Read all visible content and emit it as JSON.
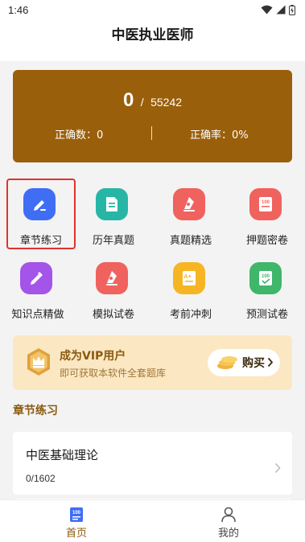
{
  "status_bar": {
    "time": "1:46"
  },
  "header": {
    "title": "中医执业医师"
  },
  "stats": {
    "done": "0",
    "separator": "/",
    "total": "55242",
    "correct_count_label": "正确数：0",
    "correct_rate_label": "正确率：0%"
  },
  "menu": [
    {
      "label": "章节练习",
      "icon": "pencil-icon",
      "color": "#3f6ef5"
    },
    {
      "label": "历年真题",
      "icon": "document-icon",
      "color": "#27b6a6"
    },
    {
      "label": "真题精选",
      "icon": "pen-nib-icon",
      "color": "#f0625e"
    },
    {
      "label": "押题密卷",
      "icon": "score-100-icon",
      "color": "#f0625e"
    },
    {
      "label": "知识点精做",
      "icon": "pencil-icon",
      "color": "#a454e8"
    },
    {
      "label": "模拟试卷",
      "icon": "pen-nib-icon",
      "color": "#f0625e"
    },
    {
      "label": "考前冲刺",
      "icon": "exam-paper-icon",
      "color": "#f6b624"
    },
    {
      "label": "预测试卷",
      "icon": "exam-check-icon",
      "color": "#3fb66a"
    }
  ],
  "vip": {
    "title": "成为VIP用户",
    "subtitle": "即可获取本软件全套题库",
    "buy_label": "购买"
  },
  "section": {
    "title": "章节练习"
  },
  "chapters": [
    {
      "name": "中医基础理论",
      "progress": "0/1602"
    }
  ],
  "tabbar": {
    "home_label": "首页",
    "mine_label": "我的"
  },
  "colors": {
    "brand_brown": "#9a5f0b",
    "vip_bg": "#fbe7c2",
    "selected_outline": "#e0322d"
  }
}
